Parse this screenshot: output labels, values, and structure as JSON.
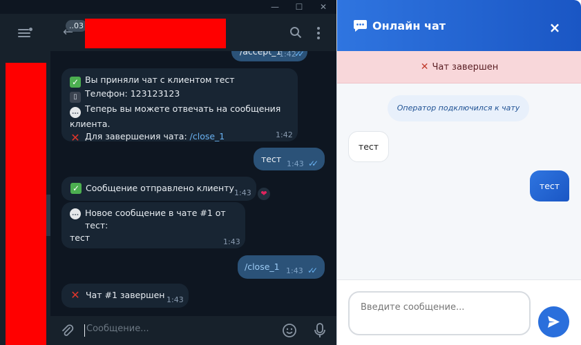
{
  "telegram": {
    "unread_count": "..03",
    "window_controls": {
      "minimize": "—",
      "maximize": "☐",
      "close": "✕"
    },
    "messages": [
      {
        "side": "out",
        "text": "/accept_1",
        "time": "1:42"
      },
      {
        "side": "in",
        "lines": [
          "Вы приняли чат с клиентом тест",
          "Телефон: 123123123",
          "Теперь вы можете отвечать на сообщения клиента.",
          "Для завершения чата: "
        ],
        "link": "/close_1",
        "time": "1:42"
      },
      {
        "side": "out",
        "text": "тест",
        "time": "1:43"
      },
      {
        "side": "in",
        "text": "Сообщение отправлено клиенту",
        "time": "1:43",
        "reaction": "❤"
      },
      {
        "side": "in",
        "text": "Новое сообщение в чате #1 от тест:",
        "text2": "тест",
        "time": "1:43"
      },
      {
        "side": "out",
        "text": "/close_1",
        "time": "1:43"
      },
      {
        "side": "in",
        "text": "Чат #1 завершен",
        "time": "1:43"
      }
    ],
    "composer": {
      "placeholder": "Сообщение..."
    }
  },
  "widget": {
    "title": "Онлайн чат",
    "close": "×",
    "status": "Чат завершен",
    "system_message": "Оператор подключился к чату",
    "incoming": "тест",
    "outgoing": "тест",
    "input_placeholder": "Введите сообщение...",
    "colors": {
      "header": "#2f75e0",
      "status_bg": "#f8d7da",
      "accent": "#2a6fdc"
    }
  },
  "icons": [
    "menu-icon",
    "back-arrow-icon",
    "search-icon",
    "more-vertical-icon",
    "checkmark-icon",
    "phone-icon",
    "speech-bubble-icon",
    "cross-icon",
    "heart-icon",
    "paperclip-icon",
    "smile-icon",
    "microphone-icon",
    "chat-icon",
    "close-icon",
    "send-icon"
  ]
}
